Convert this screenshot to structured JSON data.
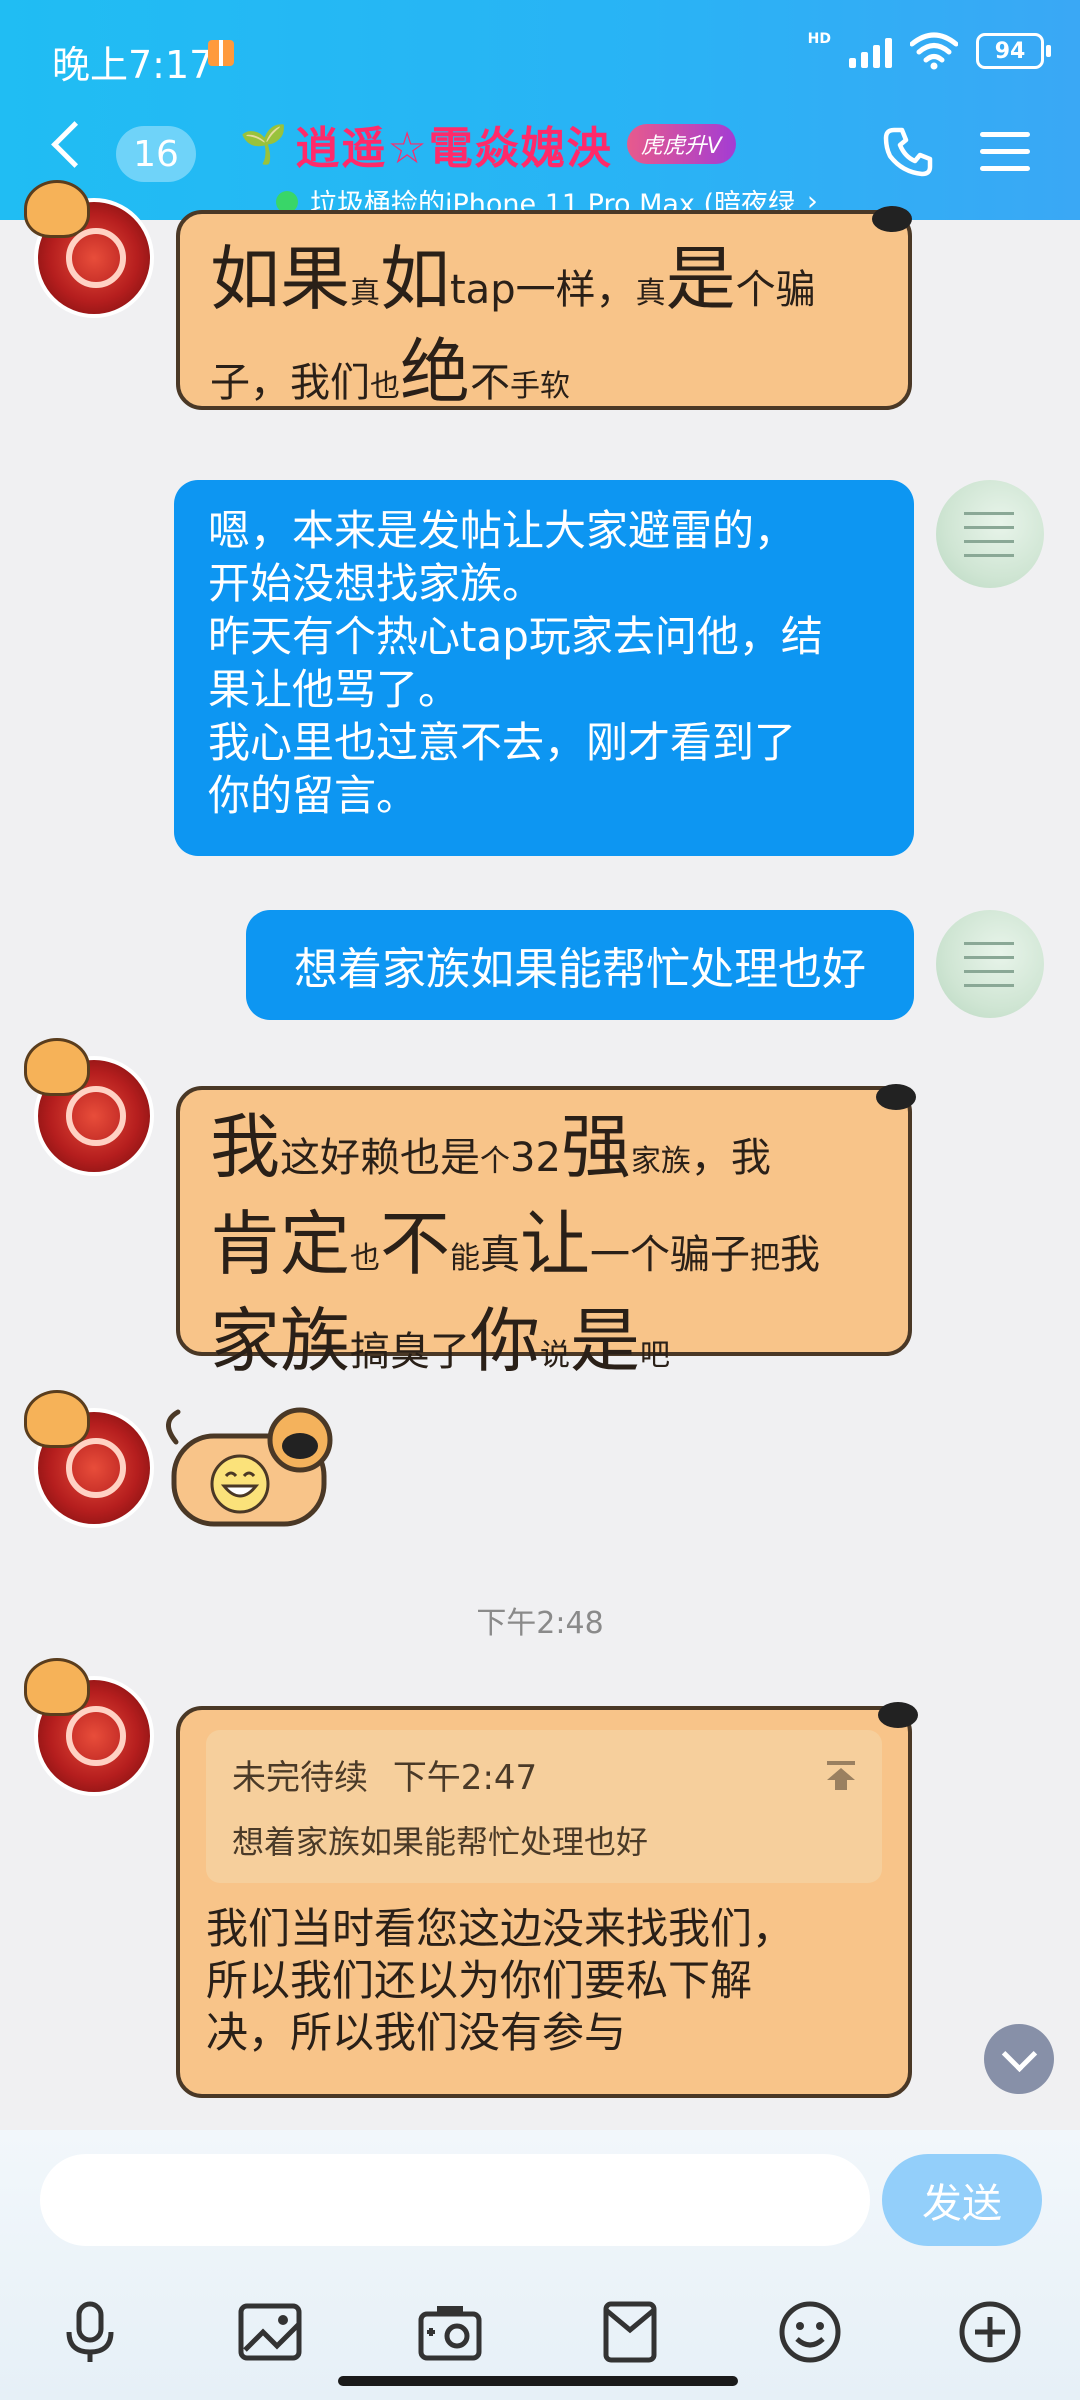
{
  "status_bar": {
    "time": "晚上7:17",
    "network": "HD",
    "battery": "94"
  },
  "header": {
    "unread_count": "16",
    "chat_name": "逍遥☆電焱媿泱",
    "vip_label": "虎虎升V",
    "subtitle": "垃圾桶捡的iPhone 11 Pro Max (暗夜绿",
    "subtitle_arrow": "›"
  },
  "messages": {
    "m1": {
      "p1": "如果",
      "p2": "真",
      "p3": "如",
      "p4": "tap一样，",
      "p5": "真",
      "p6": "是",
      "p7": "个骗",
      "p8": "子，我们",
      "p9": "也",
      "p10": "绝",
      "p11": "不",
      "p12": "手软"
    },
    "m2": {
      "lines": [
        "嗯，本来是发帖让大家避雷的，",
        "开始没想找家族。",
        "昨天有个热心tap玩家去问他，结",
        "果让他骂了。",
        "我心里也过意不去，刚才看到了",
        "你的留言。"
      ]
    },
    "m3": {
      "text": "想着家族如果能帮忙处理也好"
    },
    "m4": {
      "p1": "我",
      "p2": "这好赖也是",
      "p3": "个",
      "p4": "32",
      "p5": "强",
      "p6": "家族",
      "p7": "，我",
      "p8": "肯定",
      "p9": "也",
      "p10": "不",
      "p11": "能",
      "p12": "真",
      "p13": "让",
      "p14": "一个骗子",
      "p15": "把",
      "p16": "我",
      "p17": "家族",
      "p18": "搞臭了",
      "p19": "你",
      "p20": "说",
      "p21": "是",
      "p22": "吧"
    },
    "time_divider": "下午2:48",
    "m6": {
      "quote_author": "未完待续",
      "quote_time": "下午2:47",
      "quote_text": "想着家族如果能帮忙处理也好",
      "lines": [
        "我们当时看您这边没来找我们，",
        "所以我们还以为你们要私下解",
        "决，所以我们没有参与"
      ]
    }
  },
  "composer": {
    "placeholder": "",
    "send_label": "发送"
  },
  "toolbar": {
    "icons": [
      "microphone-icon",
      "image-icon",
      "camera-icon",
      "red-packet-icon",
      "emoji-icon",
      "plus-icon"
    ]
  },
  "colors": {
    "header": "#20bdf3",
    "bubble_blue": "#0d96f2",
    "bubble_tiger": "#f8c489",
    "chat_name": "#ff2a6a"
  }
}
